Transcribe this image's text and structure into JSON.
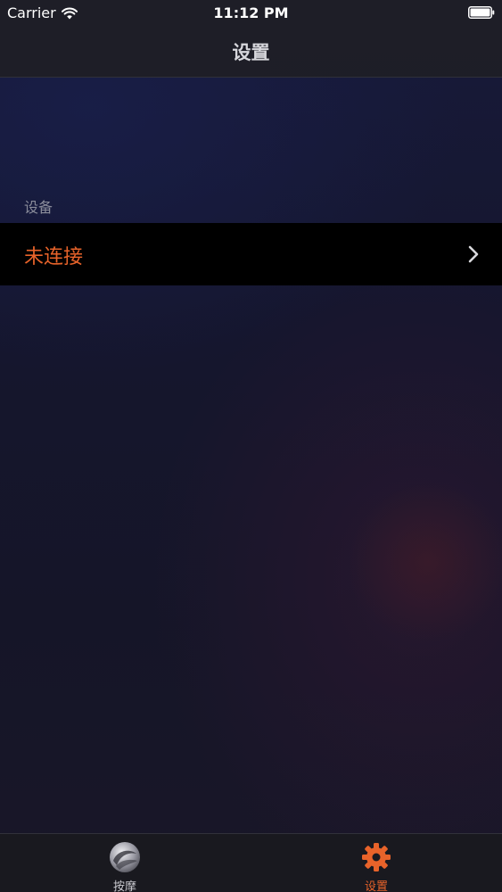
{
  "status_bar": {
    "carrier": "Carrier",
    "time": "11:12 PM",
    "wifi_icon": "wifi-icon",
    "battery_icon": "battery-icon"
  },
  "nav": {
    "title": "设置"
  },
  "settings": {
    "section_header": "设备",
    "device_row": {
      "status": "未连接",
      "chevron_icon": "chevron-right-icon"
    }
  },
  "tab_bar": {
    "tabs": [
      {
        "label": "按摩",
        "icon": "massage-icon",
        "selected": false
      },
      {
        "label": "设置",
        "icon": "gear-icon",
        "selected": true
      }
    ]
  },
  "colors": {
    "accent": "#e8632a",
    "nav_title": "#d7d7dc",
    "section_header": "#8a8c9a",
    "row_background": "#000000"
  }
}
